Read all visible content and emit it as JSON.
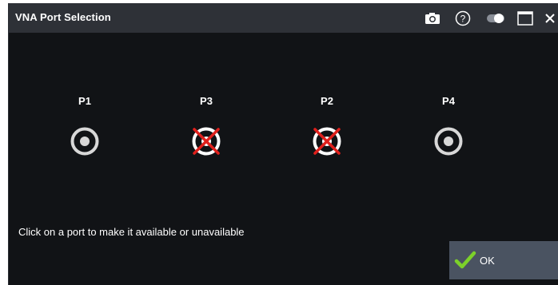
{
  "window": {
    "title": "VNA Port Selection"
  },
  "titlebar_icons": [
    "camera-icon",
    "help-icon",
    "toggle-icon",
    "maximize-icon",
    "close-icon"
  ],
  "ports": [
    {
      "label": "P1",
      "available": true
    },
    {
      "label": "P3",
      "available": false
    },
    {
      "label": "P2",
      "available": false
    },
    {
      "label": "P4",
      "available": true
    }
  ],
  "hint": "Click on a port to make it available or unavailable",
  "ok_button": {
    "label": "OK"
  },
  "colors": {
    "background": "#111316",
    "titlebar": "#2e3137",
    "button": "#4a5361",
    "check": "#7cd12a",
    "unavailable_cross": "#e0201c"
  }
}
